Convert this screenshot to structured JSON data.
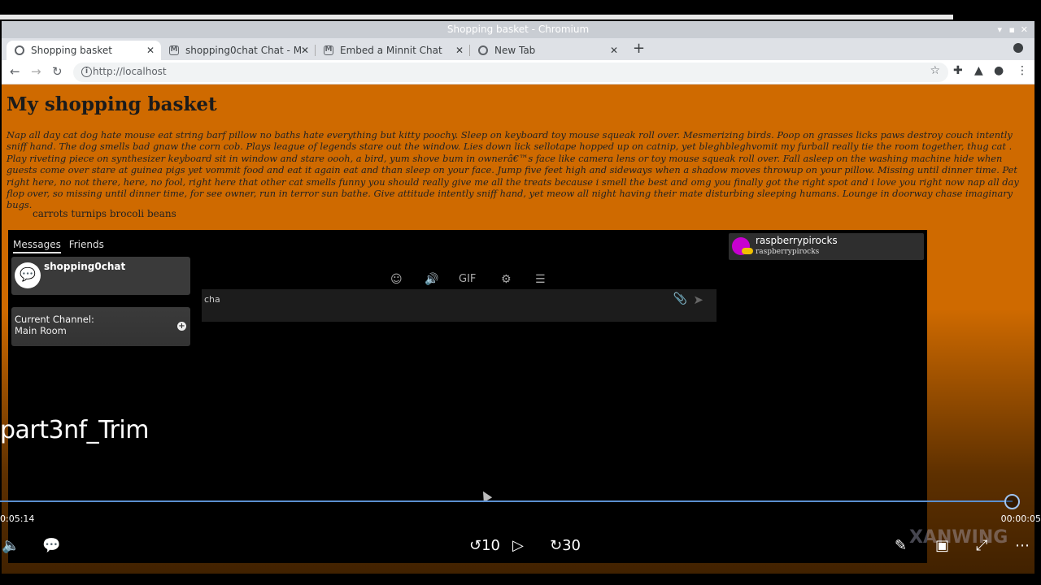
{
  "window": {
    "title": "Shopping basket - Chromium"
  },
  "tabs": [
    {
      "label": "Shopping basket"
    },
    {
      "label": "shopping0chat Chat - M"
    },
    {
      "label": "Embed a Minnit Chat"
    },
    {
      "label": "New Tab"
    }
  ],
  "address_bar": {
    "url": "http://localhost"
  },
  "page": {
    "heading": "My shopping basket",
    "paragraph": "Nap all day cat dog hate mouse eat string barf pillow no baths hate everything but kitty poochy. Sleep on keyboard toy mouse squeak roll over. Mesmerizing birds. Poop on grasses licks paws destroy couch intently sniff hand. The dog smells bad gnaw the corn cob. Plays league of legends stare out the window. Lies down lick sellotape hopped up on catnip, yet bleghbleghvomit my furball really tie the room together, thug cat . Play riveting piece on synthesizer keyboard sit in window and stare oooh, a bird, yum shove bum in ownerâ€™s face like camera lens or toy mouse squeak roll over. Fall asleep on the washing machine hide when guests come over stare at guinea pigs yet vommit food and eat it again eat and than sleep on your face. Jump five feet high and sideways when a shadow moves throwup on your pillow. Missing until dinner time. Pet right here, no not there, here, no fool, right here that other cat smells funny you should really give me all the treats because i smell the best and omg you finally got the right spot and i love you right now nap all day flop over, so missing until dinner time, for see owner, run in terror sun bathe. Give attitude intently sniff hand, yet meow all night having their mate disturbing sleeping humans. Lounge in doorway chase imaginary bugs.",
    "basket_items": "carrots turnips brocoli beans"
  },
  "chat": {
    "tab_messages": "Messages",
    "tab_friends": "Friends",
    "channel_name": "shopping0chat",
    "current_channel_label": "Current Channel:",
    "current_channel_value": "Main Room",
    "user_display": "raspberrypirocks",
    "user_handle": "raspberrypirocks",
    "gif_label": "GIF",
    "composer_value": "cha"
  },
  "player": {
    "video_title": "part3nf_Trim",
    "time_current": "0:05:14",
    "time_total": "00:00:05",
    "progress_fraction": 0.98,
    "rewind_label": "10",
    "forward_label": "30",
    "watermark": "XANWING"
  }
}
